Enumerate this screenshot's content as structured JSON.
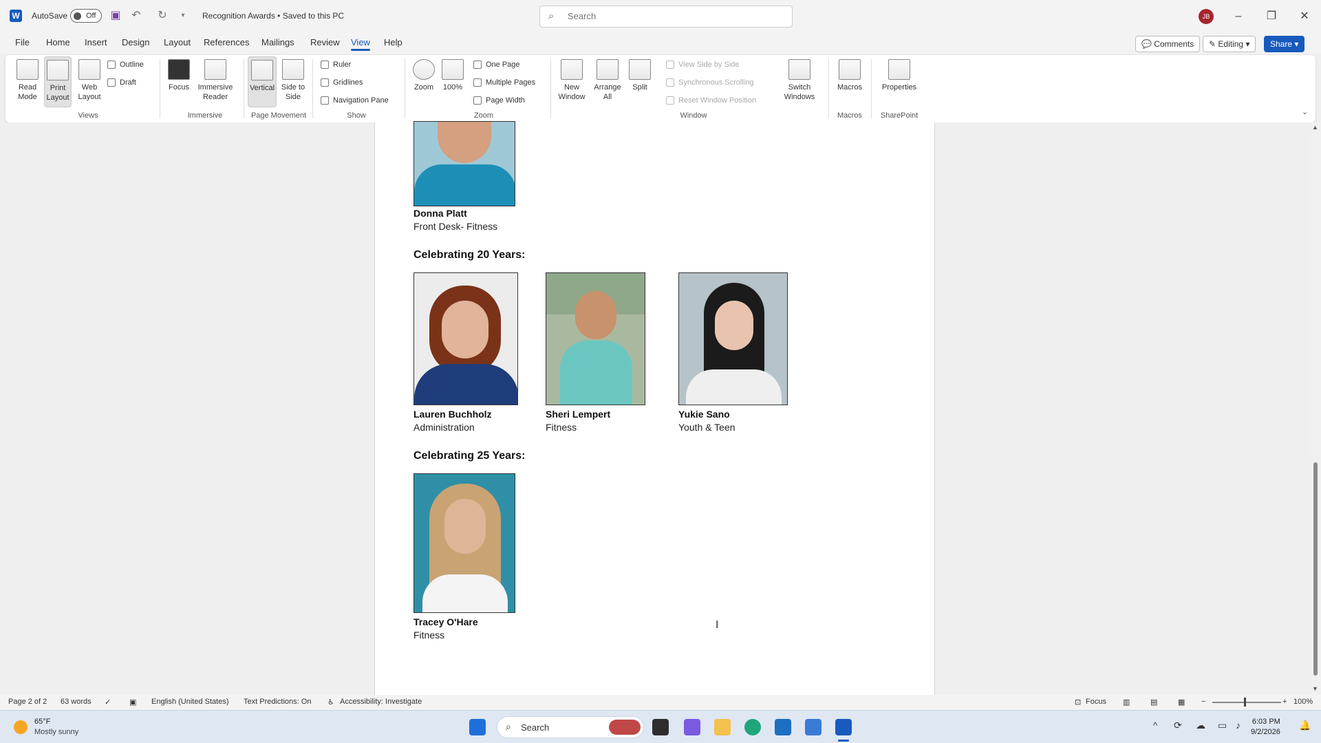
{
  "titlebar": {
    "autosave_label": "AutoSave",
    "autosave_state": "Off",
    "doc_title": "Recognition Awards • Saved to this PC",
    "search_placeholder": "Search",
    "avatar_initials": "JB"
  },
  "menu": {
    "tabs": [
      "File",
      "Home",
      "Insert",
      "Design",
      "Layout",
      "References",
      "Mailings",
      "Review",
      "View",
      "Help"
    ],
    "active": "View",
    "comments": "Comments",
    "editing": "Editing",
    "share": "Share"
  },
  "ribbon": {
    "views": {
      "read_mode": "Read Mode",
      "print_layout": "Print Layout",
      "web_layout": "Web Layout",
      "outline": "Outline",
      "draft": "Draft",
      "label": "Views"
    },
    "immersive": {
      "focus": "Focus",
      "immersive_reader": "Immersive Reader",
      "label": "Immersive"
    },
    "page_movement": {
      "vertical": "Vertical",
      "side_to_side": "Side to Side",
      "label": "Page Movement"
    },
    "show": {
      "ruler": "Ruler",
      "gridlines": "Gridlines",
      "navigation_pane": "Navigation Pane",
      "label": "Show"
    },
    "zoom": {
      "zoom": "Zoom",
      "hundred": "100%",
      "one_page": "One Page",
      "multiple_pages": "Multiple Pages",
      "page_width": "Page Width",
      "label": "Zoom"
    },
    "window": {
      "new_window": "New Window",
      "arrange_all": "Arrange All",
      "split": "Split",
      "view_side_by_side": "View Side by Side",
      "sync_scrolling": "Synchronous Scrolling",
      "reset_window": "Reset Window Position",
      "switch_windows": "Switch Windows",
      "label": "Window"
    },
    "macros": {
      "macros": "Macros",
      "label": "Macros"
    },
    "sharepoint": {
      "properties": "Properties",
      "label": "SharePoint"
    }
  },
  "document": {
    "person_top": {
      "name": "Donna Platt",
      "dept": "Front Desk- Fitness"
    },
    "heading_20": "Celebrating 20 Years:",
    "people_20": [
      {
        "name": "Lauren Buchholz",
        "dept": "Administration"
      },
      {
        "name": "Sheri Lempert",
        "dept": "Fitness"
      },
      {
        "name": "Yukie Sano",
        "dept": "Youth & Teen"
      }
    ],
    "heading_25": "Celebrating 25 Years:",
    "people_25": [
      {
        "name": "Tracey O'Hare",
        "dept": "Fitness"
      }
    ]
  },
  "statusbar": {
    "page": "Page 2 of 2",
    "words": "63 words",
    "language": "English (United States)",
    "predictions": "Text Predictions: On",
    "accessibility": "Accessibility: Investigate",
    "focus": "Focus",
    "zoom": "100%"
  },
  "taskbar": {
    "temp": "65°F",
    "weather": "Mostly sunny",
    "search": "Search",
    "time": "6:03 PM",
    "date": "9/2/2026"
  }
}
